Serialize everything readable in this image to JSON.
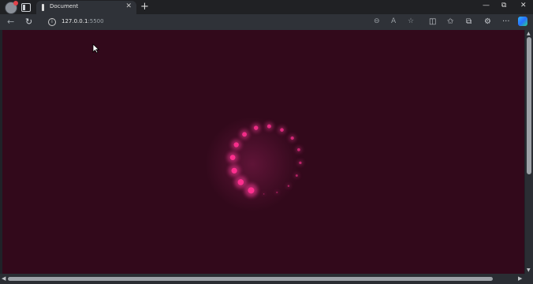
{
  "browser": {
    "tab": {
      "title": "Document",
      "close_glyph": "✕"
    },
    "new_tab_glyph": "+",
    "window_controls": {
      "minimize": "—",
      "restore": "⧉",
      "close": "✕"
    },
    "toolbar": {
      "back_glyph": "←",
      "reload_glyph": "↻",
      "info_glyph": "i",
      "url_host": "127.0.0.1",
      "url_port": ":5500",
      "zoom_glyph": "⊖",
      "read_aloud_glyph": "A",
      "favorite_glyph": "☆",
      "split_glyph": "◫",
      "favorites_glyph": "✩",
      "collections_glyph": "⧉",
      "extensions_glyph": "⚙",
      "more_glyph": "···"
    }
  },
  "page": {
    "background_color": "#32091b",
    "spinner": {
      "accent_color": "#ff2f8f",
      "glow_color": "#ff3a9a",
      "dot_count": 16
    }
  },
  "scrollbars": {
    "up": "▲",
    "down": "▼",
    "left": "◀",
    "right": "▶"
  }
}
